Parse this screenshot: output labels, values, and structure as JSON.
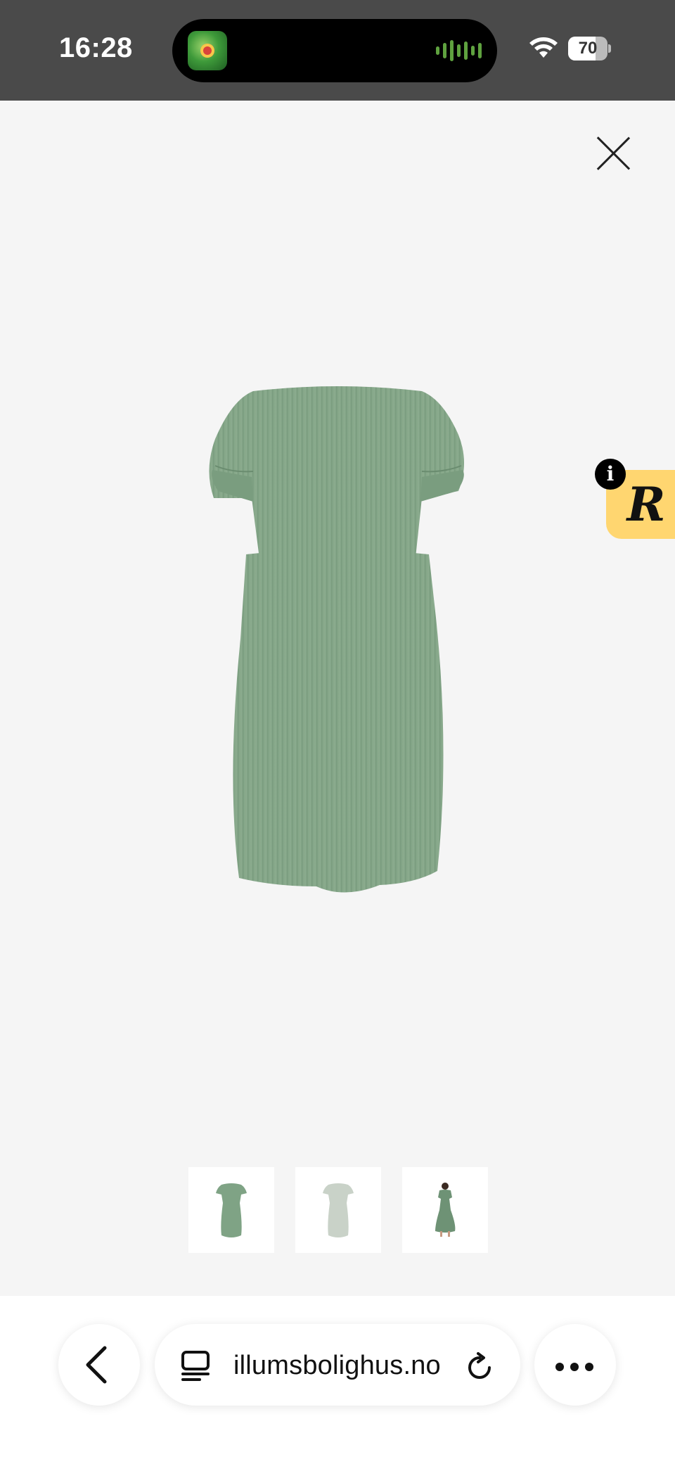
{
  "status_bar": {
    "time": "16:28",
    "battery": "70",
    "battery_level": 0.7,
    "colors": {
      "background": "#4a4a4a",
      "wave": "#5fa23f"
    },
    "icons": [
      "app-thumbnail-icon",
      "audio-wave-icon",
      "wifi-icon",
      "battery-icon"
    ]
  },
  "viewer": {
    "close_icon": "close-icon",
    "main_image_alt": "Green dress back view",
    "thumbnails": [
      {
        "alt": "Green dress back view thumbnail",
        "color": "#7fa385"
      },
      {
        "alt": "Light green dress front view thumbnail",
        "color": "#c9d2c8"
      },
      {
        "alt": "Model wearing green dress thumbnail",
        "color": "#6e9275"
      }
    ],
    "product_color": "#85aa89"
  },
  "widget": {
    "info_label": "i",
    "letter": "R",
    "color": "#ffd670"
  },
  "browser": {
    "url": "illumsbolighus.no",
    "icons": [
      "back-chevron-icon",
      "tabs-icon",
      "reload-icon",
      "more-icon"
    ]
  }
}
